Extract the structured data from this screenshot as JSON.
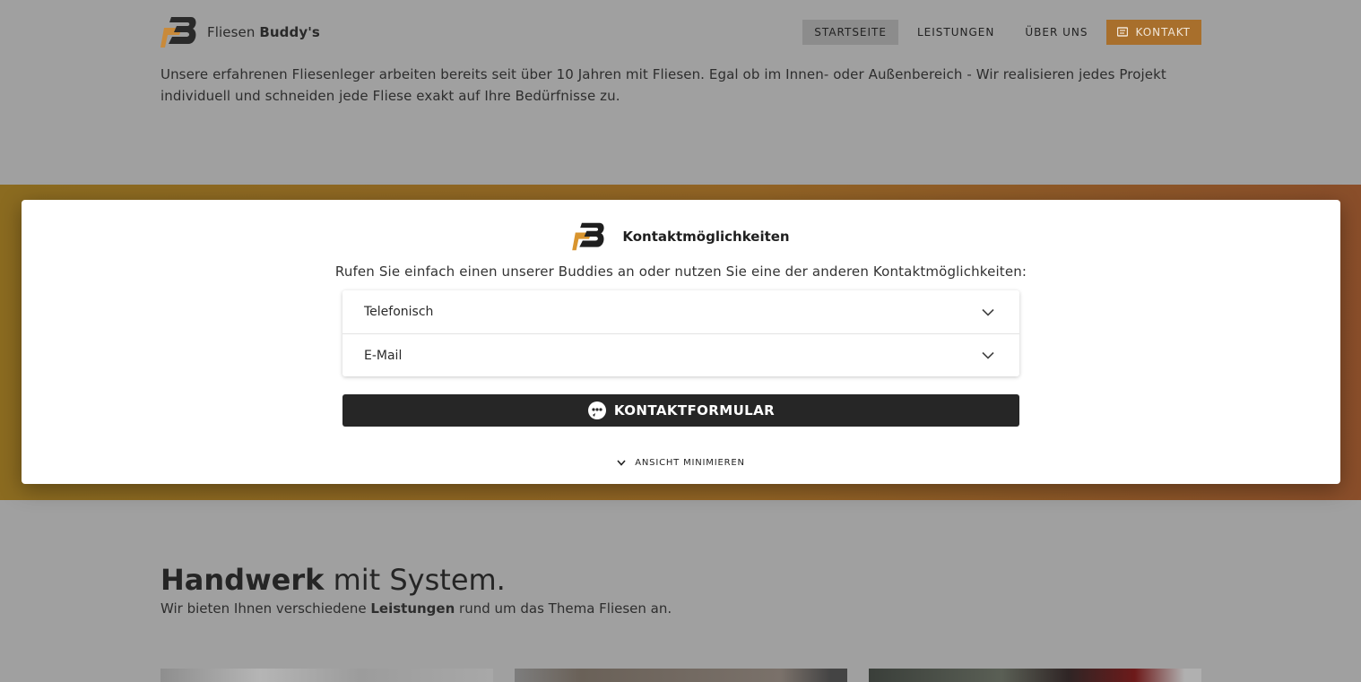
{
  "brand": {
    "name_light": "Fliesen",
    "name_bold": "Buddy's",
    "logo_text": "FB"
  },
  "nav": {
    "items": [
      {
        "label": "STARTSEITE",
        "active": true
      },
      {
        "label": "LEISTUNGEN",
        "active": false
      },
      {
        "label": "ÜBER UNS",
        "active": false
      }
    ],
    "contact_label": "KONTAKT",
    "contact_icon": "message-icon"
  },
  "intro": {
    "text": "Unsere erfahrenen Fliesenleger arbeiten bereits seit über 10 Jahren mit Fliesen. Egal ob im Innen- oder Außenbereich - Wir realisieren jedes Projekt individuell und schneiden jede Fliese exakt auf Ihre Bedürfnisse zu."
  },
  "modal": {
    "title": "Kontaktmöglichkeiten",
    "description": "Rufen Sie einfach einen unserer Buddies an oder nutzen Sie eine der anderen Kontaktmöglichkeiten:",
    "accordion": [
      {
        "label": "Telefonisch"
      },
      {
        "label": "E-Mail"
      }
    ],
    "form_button": "KONTAKTFORMULAR",
    "minimize_label": "ANSICHT MINIMIEREN"
  },
  "handwerk": {
    "title_bold": "Handwerk",
    "title_rest": " mit System.",
    "sub_before": "Wir bieten Ihnen verschiedene ",
    "sub_bold": "Leistungen",
    "sub_after": " rund um das Thema Fliesen an."
  },
  "colors": {
    "accent": "#E69A3F",
    "overlay": "#9E9E9E",
    "button_dark": "#262626"
  }
}
